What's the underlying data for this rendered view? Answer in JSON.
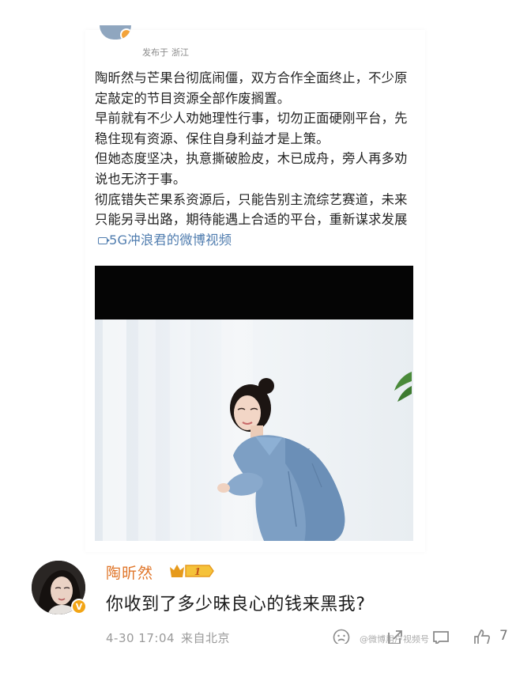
{
  "post": {
    "meta_label": "发布于",
    "meta_location": "浙江",
    "paragraphs": [
      "陶昕然与芒果台彻底闹僵，双方合作全面终止，不少原定敲定的节目资源全部作废搁置。",
      "早前就有不少人劝她理性行事，切勿正面硬刚平台，先稳住现有资源、保住自身利益才是上策。",
      "但她态度坚决，执意撕破脸皮，木已成舟，旁人再多劝说也无济于事。",
      "彻底错失芒果系资源后，只能告别主流综艺赛道，未来只能另寻出路，期待能遇上合适的平台，重新谋求发展"
    ],
    "video_link": "5G冲浪君的微博视频",
    "video_icon": "video-camera-icon"
  },
  "reply": {
    "name": "陶昕然",
    "level": "1",
    "text": "你收到了多少昧良心的钱来黑我?",
    "time": "4-30 17:04",
    "location": "来自北京",
    "like_count": "7",
    "verified_mark": "V",
    "accent_color": "#e0762a"
  },
  "watermark": "@微博用户视频号"
}
